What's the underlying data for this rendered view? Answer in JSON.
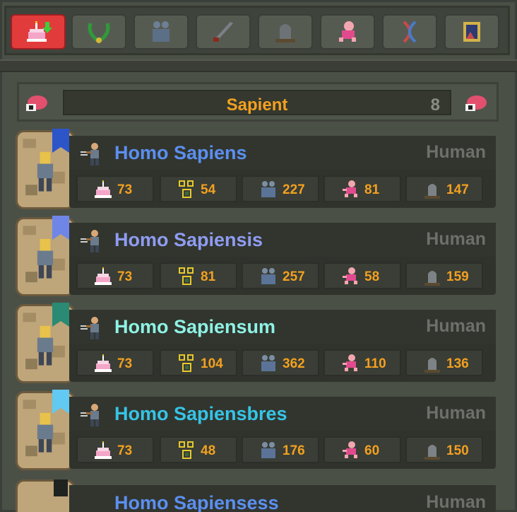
{
  "tabs": [
    {
      "name": "cake-age-icon",
      "active": true
    },
    {
      "name": "laurel-wreath-icon",
      "active": false
    },
    {
      "name": "population-icon",
      "active": false
    },
    {
      "name": "sword-icon",
      "active": false
    },
    {
      "name": "gravestone-icon",
      "active": false
    },
    {
      "name": "dancing-pig-icon",
      "active": false
    },
    {
      "name": "dna-icon",
      "active": false
    },
    {
      "name": "framed-picture-icon",
      "active": false
    }
  ],
  "header": {
    "title": "Sapient",
    "count": "8"
  },
  "stat_icons": [
    "cake-icon",
    "family-tree-icon",
    "population-icon",
    "dancing-pig-icon",
    "gravestone-icon"
  ],
  "species": [
    {
      "name": "Homo Sapiens",
      "race": "Human",
      "color": "#5b8ff0",
      "flag": "#2c55c9",
      "stats": [
        "73",
        "54",
        "227",
        "81",
        "147"
      ]
    },
    {
      "name": "Homo Sapiensis",
      "race": "Human",
      "color": "#8f9cf2",
      "flag": "#6f86e6",
      "stats": [
        "73",
        "81",
        "257",
        "58",
        "159"
      ]
    },
    {
      "name": "Homo Sapiensum",
      "race": "Human",
      "color": "#8ef2e4",
      "flag": "#2a8a73",
      "stats": [
        "73",
        "104",
        "362",
        "110",
        "136"
      ]
    },
    {
      "name": "Homo Sapiensbres",
      "race": "Human",
      "color": "#36c4e6",
      "flag": "#62c9f2",
      "stats": [
        "73",
        "48",
        "176",
        "60",
        "150"
      ]
    }
  ],
  "partial_row": {
    "name": "Homo Sapiensess",
    "race": "Human"
  }
}
